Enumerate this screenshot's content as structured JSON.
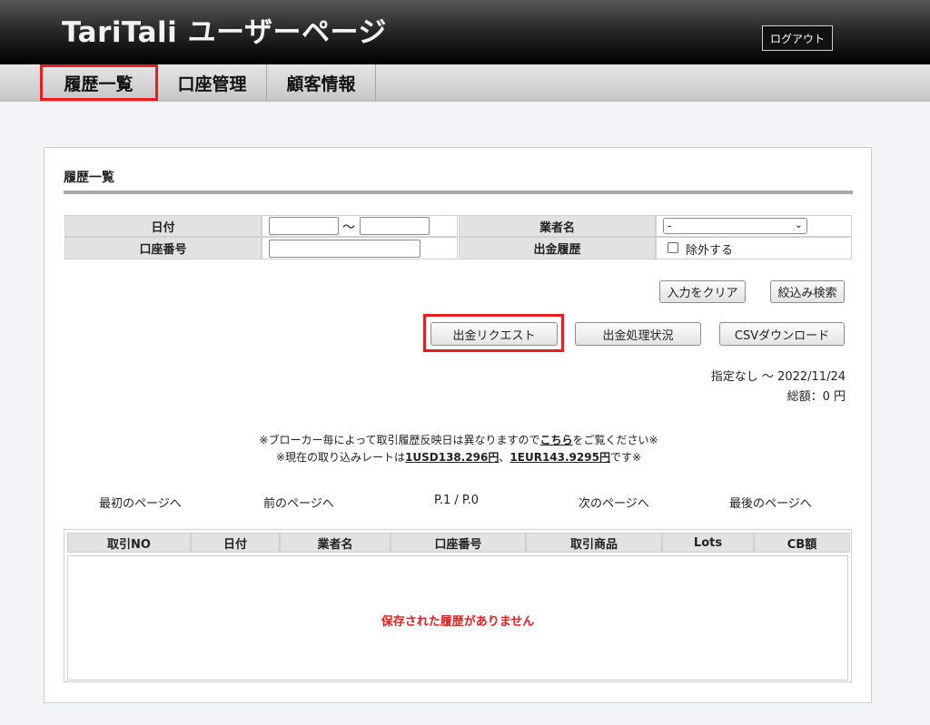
{
  "header": {
    "title": "TariTali ユーザーページ",
    "logout_label": "ログアウト"
  },
  "nav": {
    "tabs": [
      {
        "label": "履歴一覧",
        "active": true
      },
      {
        "label": "口座管理",
        "active": false
      },
      {
        "label": "顧客情報",
        "active": false
      }
    ]
  },
  "panel": {
    "title": "履歴一覧"
  },
  "filters": {
    "date_label": "日付",
    "date_from": "",
    "date_separator": "〜",
    "date_to": "",
    "broker_label": "業者名",
    "broker_selected": "-",
    "account_label": "口座番号",
    "account_value": "",
    "withdrawal_label": "出金履歴",
    "exclude_checked": false,
    "exclude_label": "除外する"
  },
  "buttons": {
    "clear": "入力をクリア",
    "search": "絞込み検索",
    "withdrawal_request": "出金リクエスト",
    "withdrawal_status": "出金処理状況",
    "csv_download": "CSVダウンロード"
  },
  "summary": {
    "range": "指定なし 〜 2022/11/24",
    "total": "総額：0 円"
  },
  "notice": {
    "line1_prefix": "※ブローカー毎によって取引履歴反映日は異なりますので",
    "line1_link": "こちら",
    "line1_suffix": "をご覧ください※",
    "line2_prefix": "※現在の取り込みレートは",
    "rate_usd": "1USD138.296円",
    "separator": "、",
    "rate_eur": "1EUR143.9295円",
    "line2_suffix": "です※"
  },
  "pagination": {
    "first": "最初のページへ",
    "prev": "前のページへ",
    "current": "P.1 / P.0",
    "next": "次のページへ",
    "last": "最後のページへ"
  },
  "table": {
    "columns": [
      "取引NO",
      "日付",
      "業者名",
      "口座番号",
      "取引商品",
      "Lots",
      "CB額"
    ],
    "rows": [],
    "empty_message": "保存された履歴がありません"
  },
  "colors": {
    "highlight": "#e81e1e",
    "header_bg": "#000000",
    "label_bg": "#e2e2e2"
  }
}
